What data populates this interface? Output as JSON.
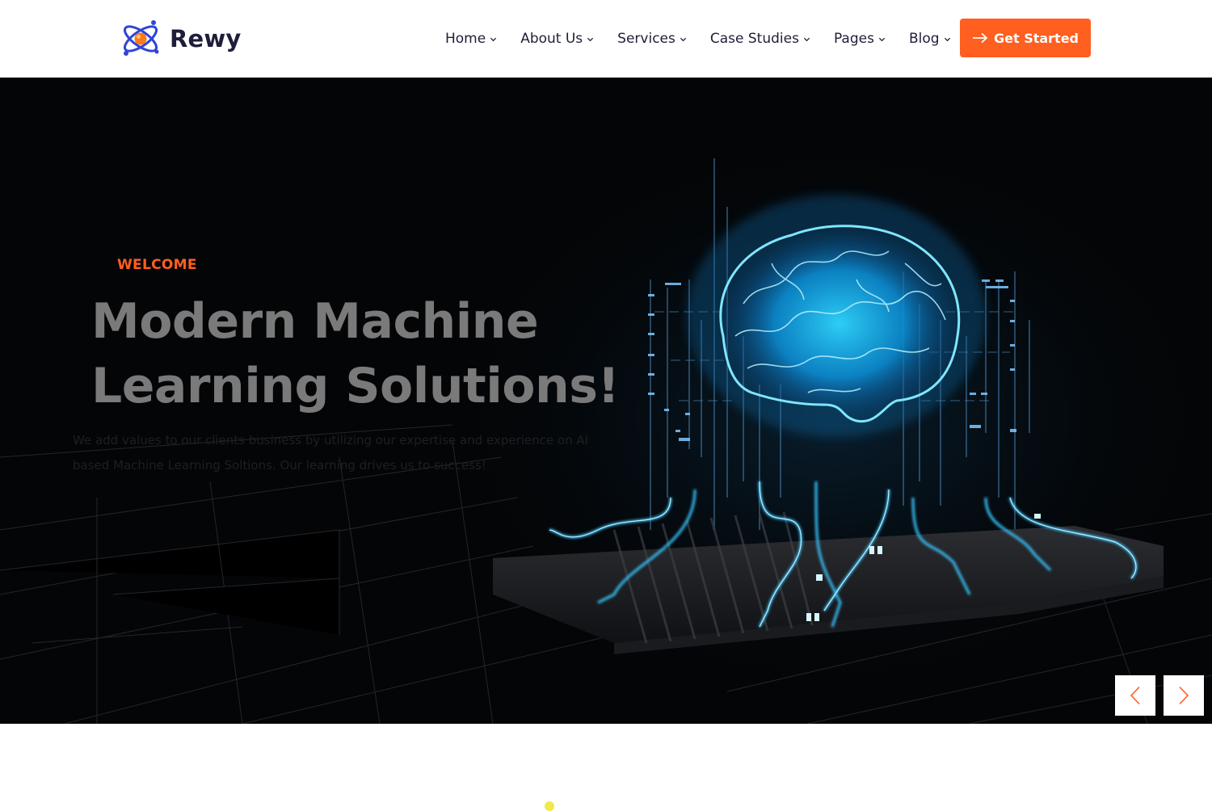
{
  "brand": {
    "name": "Rewy",
    "logo_icon": "atom-icon",
    "primary_color": "#ff5f1f",
    "text_color": "#1e1e3a"
  },
  "nav": {
    "items": [
      {
        "label": "Home",
        "icon": "chevron-down-icon"
      },
      {
        "label": "About Us",
        "icon": "chevron-down-icon"
      },
      {
        "label": "Services",
        "icon": "chevron-down-icon"
      },
      {
        "label": "Case Studies",
        "icon": "chevron-down-icon"
      },
      {
        "label": "Pages",
        "icon": "chevron-down-icon"
      },
      {
        "label": "Blog",
        "icon": "chevron-down-icon"
      }
    ],
    "cta": {
      "label": "Get Started",
      "icon": "arrow-right-icon"
    }
  },
  "hero": {
    "eyebrow": "WELCOME",
    "title_line1": "Modern Machine",
    "title_line2": "Learning Solutions!",
    "description": "We add values to our clients business by utilizing our expertise and experience on AI based Machine Learning Soltions. Our learning drives us to success!",
    "background_image": "glowing-brain-on-chip",
    "accent_glow": "#1ec8ff",
    "slider": {
      "prev_icon": "chevron-left-icon",
      "next_icon": "chevron-right-icon"
    }
  }
}
